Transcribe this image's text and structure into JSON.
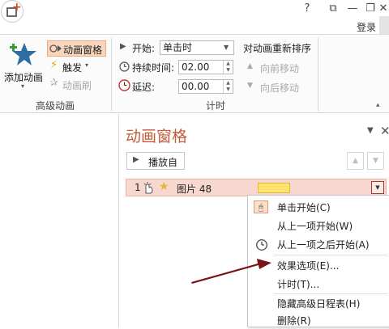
{
  "titlebar": {
    "app_icon": "powerpoint-new-icon",
    "help_label": "?",
    "ribbon_toggle_label": "⧉",
    "minimize_label": "—",
    "restore_label": "❐",
    "close_label": "✕",
    "login_label": "登录"
  },
  "ribbon": {
    "add_animation_label": "添加动画",
    "add_animation_arrow": "▾",
    "animation_pane_label": "动画窗格",
    "trigger_label": "触发",
    "trigger_arrow": "▾",
    "animation_painter_label": "动画刷",
    "group_advanced_label": "高级动画",
    "start_label": "开始:",
    "start_value": "单击时",
    "duration_label": "持续时间:",
    "duration_value": "02.00",
    "delay_label": "延迟:",
    "delay_value": "00.00",
    "group_timing_label": "计时",
    "reorder_title": "对动画重新排序",
    "move_earlier_label": "向前移动",
    "move_later_label": "向后移动",
    "collapse_label": "▴"
  },
  "pane": {
    "title": "动画窗格",
    "dropdown_label": "▼",
    "close_label": "✕",
    "play_label": "播放自",
    "up_label": "▲",
    "down_label": "▼",
    "row": {
      "index": "1",
      "name": "图片 48",
      "dropdown_label": "▼"
    }
  },
  "context_menu": {
    "items": [
      {
        "label": "单击开始(C)"
      },
      {
        "label": "从上一项开始(W)"
      },
      {
        "label": "从上一项之后开始(A)"
      },
      {
        "label": "效果选项(E)..."
      },
      {
        "label": "计时(T)..."
      },
      {
        "label": "隐藏高级日程表(H)"
      },
      {
        "label": "删除(R)"
      }
    ]
  },
  "colors": {
    "accent": "#c55a3a",
    "selected_row": "#f8d7cf",
    "timing_bar": "#fee26b",
    "star": "#2e6da4",
    "annotation_arrow": "#7a1515"
  }
}
